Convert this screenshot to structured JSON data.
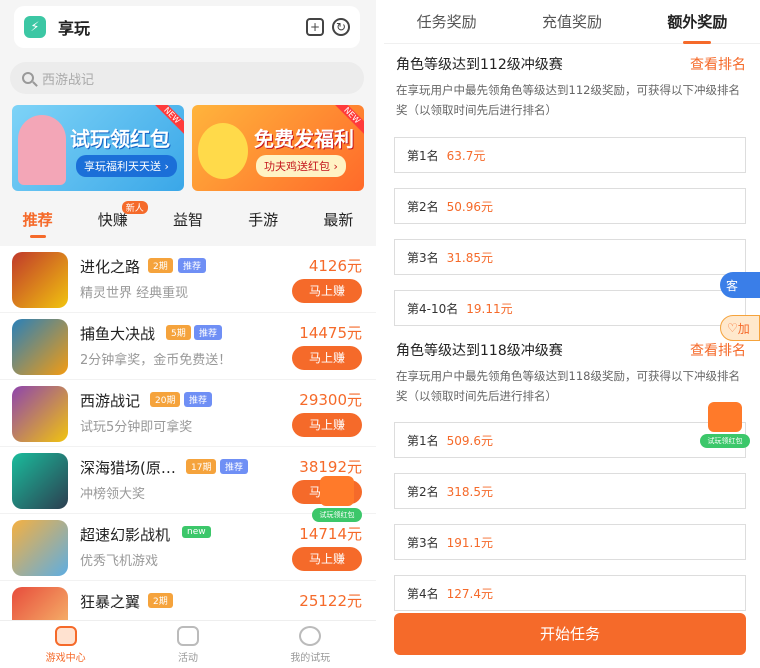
{
  "left": {
    "app_title": "享玩",
    "search_placeholder": "西游战记",
    "banners": [
      {
        "badge": "NEW",
        "title": "试玩领红包",
        "pill": "享玩福利天天送 ›"
      },
      {
        "badge": "NEW",
        "title": "免费发福利",
        "pill": "功夫鸡送红包 ›"
      }
    ],
    "tabs": [
      {
        "label": "推荐",
        "badge": ""
      },
      {
        "label": "快赚",
        "badge": "新人"
      },
      {
        "label": "益智",
        "badge": ""
      },
      {
        "label": "手游",
        "badge": ""
      },
      {
        "label": "最新",
        "badge": ""
      }
    ],
    "games": [
      {
        "name": "进化之路",
        "tag": "2期",
        "tag2": "推荐",
        "desc": "精灵世界 经典重现",
        "amount": "4126元",
        "button": "马上赚"
      },
      {
        "name": "捕鱼大决战",
        "tag": "5期",
        "tag2": "推荐",
        "desc": "2分钟拿奖，金币免费送！",
        "amount": "14475元",
        "button": "马上赚"
      },
      {
        "name": "西游战记",
        "tag": "20期",
        "tag2": "推荐",
        "desc": "试玩5分钟即可拿奖",
        "amount": "29300元",
        "button": "马上赚"
      },
      {
        "name": "深海猎场(原…",
        "tag": "17期",
        "tag2": "推荐",
        "desc": "冲榜领大奖",
        "amount": "38192元",
        "button": "马上赚"
      },
      {
        "name": "超速幻影战机",
        "tag": "new",
        "tag2": "",
        "desc": "优秀飞机游戏",
        "amount": "14714元",
        "button": "马上赚"
      },
      {
        "name": "狂暴之翼",
        "tag": "2期",
        "tag2": "",
        "desc": "",
        "amount": "25122元",
        "button": ""
      }
    ],
    "redpack_label": "试玩领红包",
    "bottom_nav": [
      {
        "label": "游戏中心"
      },
      {
        "label": "活动"
      },
      {
        "label": "我的试玩"
      }
    ]
  },
  "right": {
    "tabs": [
      "任务奖励",
      "充值奖励",
      "额外奖励"
    ],
    "sections": [
      {
        "title": "角色等级达到112级冲级赛",
        "link": "查看排名",
        "desc": "在享玩用户中最先领角色等级达到112级奖励，可获得以下冲级排名奖（以领取时间先后进行排名）",
        "ranks": [
          {
            "rank": "第1名",
            "value": "63.7元"
          },
          {
            "rank": "第2名",
            "value": "50.96元"
          },
          {
            "rank": "第3名",
            "value": "31.85元"
          },
          {
            "rank": "第4-10名",
            "value": "19.11元"
          }
        ]
      },
      {
        "title": "角色等级达到118级冲级赛",
        "link": "查看排名",
        "desc": "在享玩用户中最先领角色等级达到118级奖励，可获得以下冲级排名奖（以领取时间先后进行排名）",
        "ranks": [
          {
            "rank": "第1名",
            "value": "509.6元"
          },
          {
            "rank": "第2名",
            "value": "318.5元"
          },
          {
            "rank": "第3名",
            "value": "191.1元"
          },
          {
            "rank": "第4名",
            "value": "127.4元"
          }
        ]
      }
    ],
    "float_buttons": [
      "客",
      "加"
    ],
    "redpack_label": "试玩领红包",
    "start_button": "开始任务"
  },
  "colors": {
    "accent": "#f56a2a",
    "tag_orange": "#f5a33c",
    "tag_blue": "#6f8ff5",
    "tag_green": "#3cc76a"
  }
}
